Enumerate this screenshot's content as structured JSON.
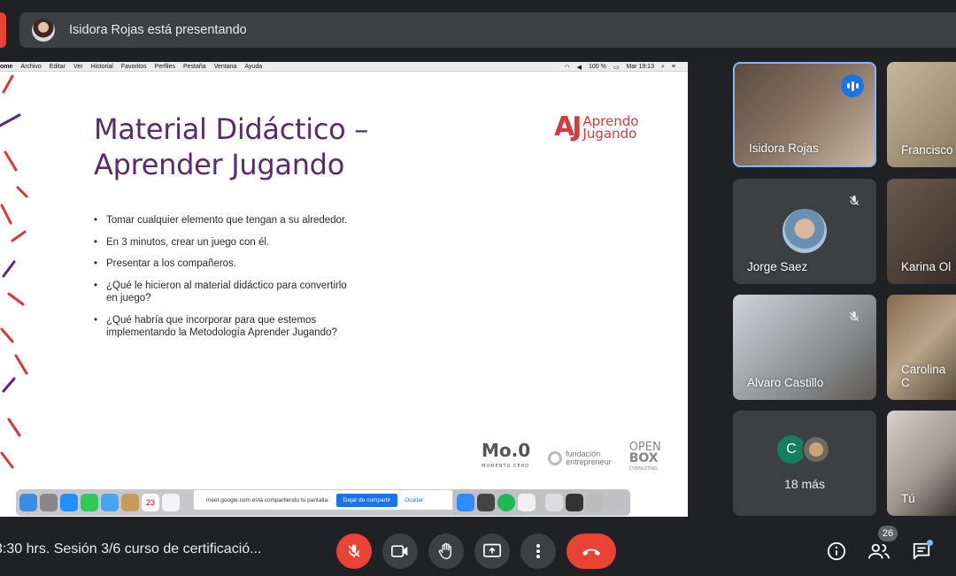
{
  "presenting_bar": {
    "text": "Isidora Rojas está presentando"
  },
  "mac_menubar": {
    "menus": [
      "ome",
      "Archivo",
      "Editar",
      "Ver",
      "Historial",
      "Favoritos",
      "Perfiles",
      "Pestaña",
      "Ventana",
      "Ayuda"
    ],
    "battery": "100 %",
    "clock": "Mar 19:13"
  },
  "slide": {
    "title_line1": "Material Didáctico –",
    "title_line2": "Aprender Jugando",
    "logo_mark": "AJ",
    "logo_word1": "Aprendo",
    "logo_word2": "Jugando",
    "bullets": [
      "Tomar cualquier elemento que tengan a su alrededor.",
      "En 3 minutos, crear un juego con él.",
      "Presentar a los compañeros.",
      "¿Qué le hicieron al material didáctico para convertirlo en juego?",
      "¿Qué habría que incorporar para que estemos implementando la Metodología Aprender Jugando?"
    ],
    "footer": {
      "moo": "Mo.0",
      "moo_sub": "MOMENTO CERO",
      "fundacion_1": "fundación",
      "fundacion_2": "entrepreneur",
      "openbox_1": "OPEN",
      "openbox_2": "BOX",
      "openbox_3": "CONSULTING"
    }
  },
  "share_banner": {
    "message": "meet.google.com está compartiendo tu pantalla.",
    "stop_label": "Dejar de compartir",
    "hide_label": "Ocultar"
  },
  "dock": {
    "calendar_day": "23"
  },
  "participants": [
    {
      "name": "Isidora Rojas",
      "state": "speaking"
    },
    {
      "name": "Francisco",
      "state": "video"
    },
    {
      "name": "Jorge Saez",
      "state": "muted"
    },
    {
      "name": "Karina Ol",
      "state": "video"
    },
    {
      "name": "Alvaro Castillo",
      "state": "muted"
    },
    {
      "name": "Carolina C",
      "state": "video"
    },
    {
      "name": "18 más",
      "avatar_letter": "C"
    },
    {
      "name": "Tú",
      "state": "video"
    }
  ],
  "bottom_bar": {
    "meeting_title": "3:30 hrs. Sesión 3/6 curso de certificació...",
    "participant_count": "26",
    "colors": {
      "hangup": "#ea4335",
      "mic_off": "#ea4335",
      "control_bg": "#3c4043"
    }
  }
}
